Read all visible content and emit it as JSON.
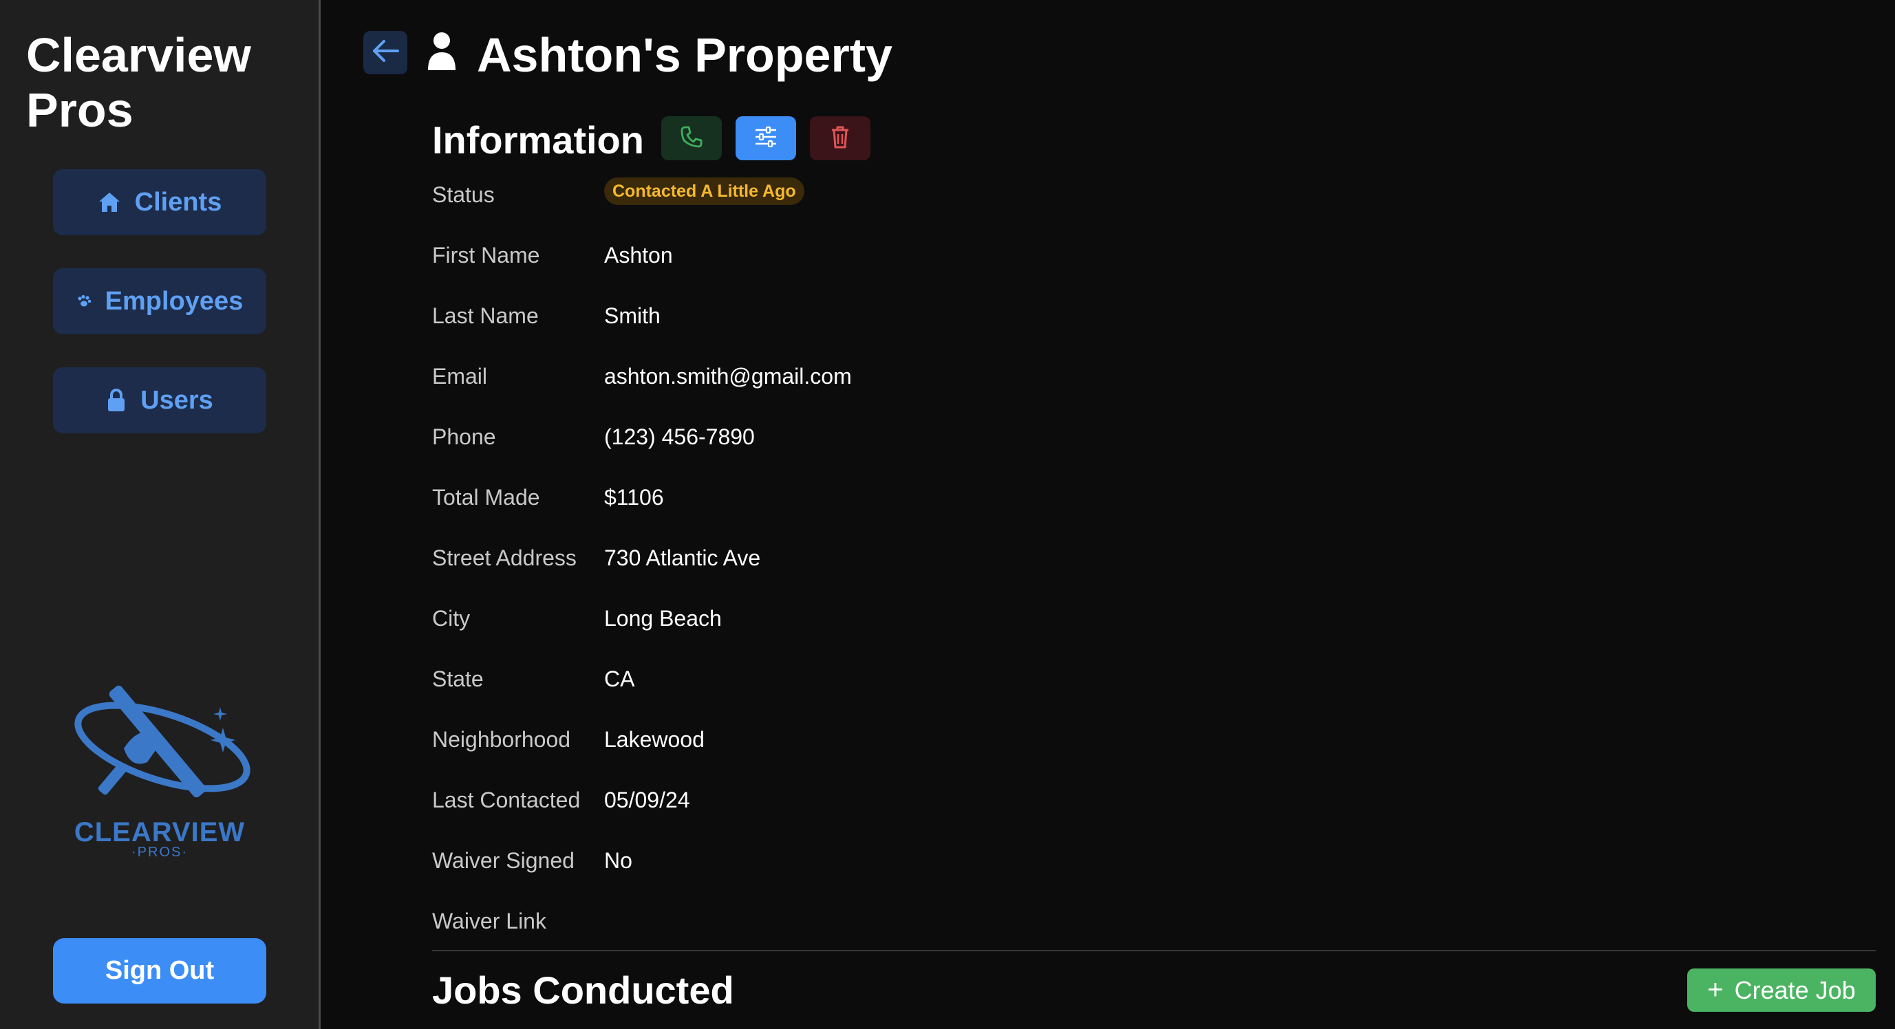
{
  "brand": {
    "name_line1": "Clearview",
    "name_line2": "Pros"
  },
  "sidebar": {
    "items": [
      {
        "label": "Clients",
        "icon": "home-icon"
      },
      {
        "label": "Employees",
        "icon": "paw-icon"
      },
      {
        "label": "Users",
        "icon": "lock-icon"
      }
    ],
    "logo": {
      "word": "CLEARVIEW",
      "sub": "·PROS·"
    },
    "sign_out_label": "Sign Out"
  },
  "header": {
    "title": "Ashton's Property",
    "back_icon": "arrow-left-icon",
    "person_icon": "person-icon"
  },
  "information": {
    "title": "Information",
    "actions": [
      {
        "name": "call",
        "icon": "phone-icon"
      },
      {
        "name": "edit",
        "icon": "sliders-icon"
      },
      {
        "name": "delete",
        "icon": "trash-icon"
      }
    ],
    "status_label": "Status",
    "status_value": "Contacted A Little Ago",
    "fields": [
      {
        "label": "First Name",
        "value": "Ashton"
      },
      {
        "label": "Last Name",
        "value": "Smith"
      },
      {
        "label": "Email",
        "value": "ashton.smith@gmail.com"
      },
      {
        "label": "Phone",
        "value": "(123) 456-7890"
      },
      {
        "label": "Total Made",
        "value": "$1106"
      },
      {
        "label": "Street Address",
        "value": "730 Atlantic Ave"
      },
      {
        "label": "City",
        "value": "Long Beach"
      },
      {
        "label": "State",
        "value": "CA"
      },
      {
        "label": "Neighborhood",
        "value": "Lakewood"
      },
      {
        "label": "Last Contacted",
        "value": "05/09/24"
      },
      {
        "label": "Waiver Signed",
        "value": "No"
      },
      {
        "label": "Waiver Link",
        "value": ""
      }
    ]
  },
  "jobs": {
    "title": "Jobs Conducted",
    "create_label": "Create Job"
  },
  "colors": {
    "accent": "#3c8ef6",
    "sidebar_bg": "#1f1f20",
    "main_bg": "#0c0c0d",
    "nav_bg": "#1c2c4a",
    "status_text": "#f5b92f",
    "delete_icon": "#e05555",
    "create_job": "#4bb462"
  }
}
